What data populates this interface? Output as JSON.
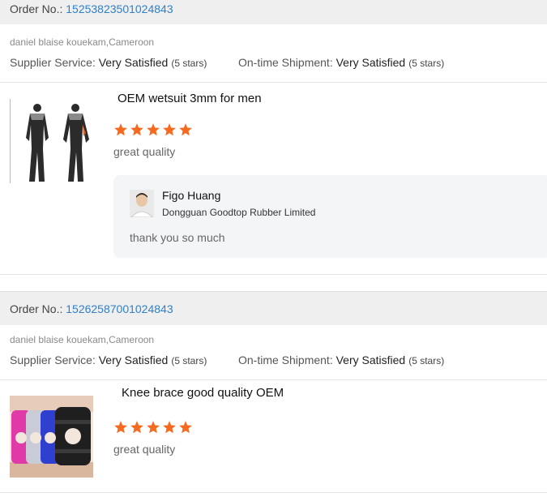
{
  "orders": [
    {
      "order_label": "Order No.: ",
      "order_number": "15253823501024843",
      "buyer": "daniel blaise kouekam,Cameroon",
      "supplier_service_label": "Supplier Service: ",
      "supplier_service_value": "Very Satisfied",
      "supplier_service_stars": "(5 stars)",
      "shipment_label": "On-time Shipment: ",
      "shipment_value": "Very Satisfied",
      "shipment_stars": "(5 stars)",
      "product_title": "OEM wetsuit 3mm for men",
      "product_icon": "wetsuit-image",
      "rating": 5,
      "comment": "great quality",
      "reply": {
        "name": "Figo Huang",
        "company": "Dongguan Goodtop Rubber Limited",
        "message": "thank you so much"
      }
    },
    {
      "order_label": "Order No.: ",
      "order_number": "15262587001024843",
      "buyer": "daniel blaise kouekam,Cameroon",
      "supplier_service_label": "Supplier Service: ",
      "supplier_service_value": "Very Satisfied",
      "supplier_service_stars": "(5 stars)",
      "shipment_label": "On-time Shipment: ",
      "shipment_value": "Very Satisfied",
      "shipment_stars": "(5 stars)",
      "product_title": "Knee brace good quality OEM",
      "product_icon": "knee-brace-image",
      "rating": 5,
      "comment": "great quality"
    }
  ],
  "colors": {
    "star": "#f56a1f",
    "order_number": "#2f80c9",
    "header_bg": "#efefef",
    "reply_bg": "#f4f5f7"
  }
}
